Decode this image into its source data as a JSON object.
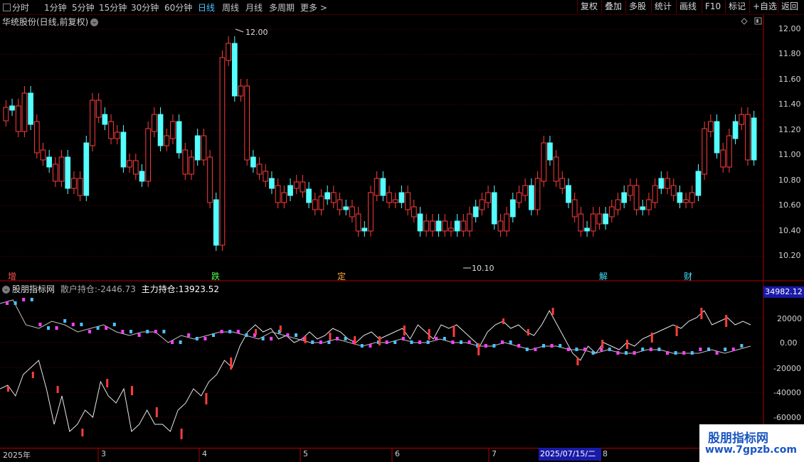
{
  "toolbar": {
    "periods": [
      "分时",
      "1分钟",
      "5分钟",
      "15分钟",
      "30分钟",
      "60分钟",
      "日线",
      "周线",
      "月线",
      "多周期",
      "更多"
    ],
    "more_arrow": ">",
    "buttons": [
      "复权",
      "叠加",
      "多股",
      "统计",
      "画线",
      "F10",
      "标记",
      "+自选",
      "返回"
    ]
  },
  "stock": {
    "title": "华统股份(日线,前复权)"
  },
  "price_axis": [
    "12.00",
    "11.80",
    "11.60",
    "11.40",
    "11.20",
    "11.00",
    "10.80",
    "10.60",
    "10.40",
    "10.20"
  ],
  "annotations": {
    "high": "12.00",
    "low": "10.10"
  },
  "event_tags": [
    {
      "text": "增",
      "color": "#ff5050"
    },
    {
      "text": "跌",
      "color": "#50ff50"
    },
    {
      "text": "定",
      "color": "#ffb040"
    },
    {
      "text": "解",
      "color": "#40e0ff"
    },
    {
      "text": "财",
      "color": "#40e0ff"
    }
  ],
  "indicator": {
    "name": "股朋指标网",
    "retail_label": "散户持仓:",
    "retail_value": "-2446.73",
    "main_label": "主力持仓:",
    "main_value": "13923.52",
    "axis_max": "34982.12",
    "axis_ticks": [
      "20000",
      "0.00",
      "-20000",
      "-40000",
      "-60000"
    ]
  },
  "date_axis": {
    "labels": [
      "2025年",
      "3",
      "4",
      "5",
      "6",
      "7",
      "8"
    ],
    "cursor": "2025/07/15/二"
  },
  "watermark": {
    "line1": "股朋指标网",
    "line2": "www.7gpzb.com"
  },
  "colors": {
    "up": "#ff3c3c",
    "down": "#54ffff",
    "accent": "#4ec1ff",
    "grid": "#6a0000"
  }
}
